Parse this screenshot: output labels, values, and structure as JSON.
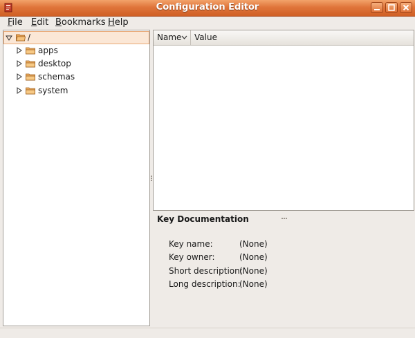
{
  "window": {
    "title": "Configuration Editor",
    "accent_color": "#e0753b"
  },
  "menubar": {
    "items": [
      {
        "mnemonic": "F",
        "rest": "ile"
      },
      {
        "mnemonic": "E",
        "rest": "dit"
      },
      {
        "mnemonic": "B",
        "rest": "ookmarks"
      },
      {
        "mnemonic": "H",
        "rest": "elp"
      }
    ]
  },
  "tree": {
    "root": {
      "label": "/",
      "expanded": true,
      "selected": true
    },
    "children": [
      {
        "label": "apps",
        "expanded": false
      },
      {
        "label": "desktop",
        "expanded": false
      },
      {
        "label": "schemas",
        "expanded": false
      },
      {
        "label": "system",
        "expanded": false
      }
    ]
  },
  "list": {
    "columns": [
      "Name",
      "Value"
    ],
    "rows": []
  },
  "documentation": {
    "title": "Key Documentation",
    "fields": [
      {
        "label": "Key name:",
        "value": "(None)"
      },
      {
        "label": "Key owner:",
        "value": "(None)"
      },
      {
        "label": "Short description:",
        "value": "(None)"
      },
      {
        "label": "Long description:",
        "value": "(None)"
      }
    ]
  },
  "icons": {
    "app": "config-editor-icon",
    "folder": "folder-icon",
    "expander_open": "triangle-down-icon",
    "expander_closed": "triangle-right-icon",
    "sort": "chevron-down-icon"
  }
}
